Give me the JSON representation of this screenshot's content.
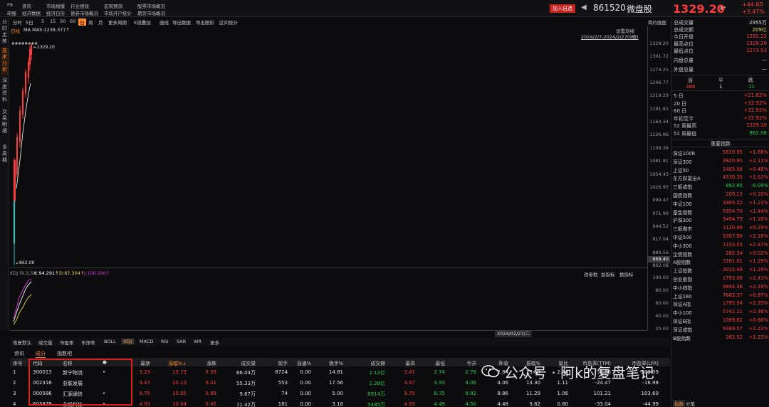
{
  "menu": {
    "row1": [
      "F9",
      "资讯",
      "市场规模",
      "行业绩效",
      "宏观预测",
      "股票市场概况"
    ],
    "row2": [
      "研报",
      "经济数据",
      "经济日历",
      "债券市场概况",
      "市场开户统计",
      "期货市场概况"
    ]
  },
  "header": {
    "add_watch": "加入自选",
    "code": "861520",
    "name": "微盘股",
    "price": "1329.20",
    "change": "+44.60",
    "change_pct": "+3.47%"
  },
  "left_tabs": [
    "分时走势",
    "技术分析",
    "深度资料",
    "交易明细",
    "多周期"
  ],
  "chart_toolbar": {
    "items": [
      "分时",
      "5日",
      "5",
      "15",
      "30",
      "60",
      "日",
      "周",
      "月",
      "更多周期",
      "K线叠加",
      "画线",
      "导出数据",
      "导出图形",
      "区间统计"
    ],
    "selected": "日",
    "right_label": "简约画面",
    "settings": "设置均线",
    "range": "2024/2/7-2024/2/27(9根)"
  },
  "ma_legend": {
    "prefix": "日线",
    "ma": "MA  MA5:1238.377↑"
  },
  "price_axis": [
    "1329.20",
    "1301.72",
    "1274.25",
    "1246.77",
    "1219.29",
    "1191.81",
    "1164.34",
    "1136.86",
    "1109.38",
    "1081.91",
    "1054.43",
    "1026.95",
    "999.47",
    "971.99",
    "944.52",
    "917.04",
    "889.56",
    "862.08"
  ],
  "price_current_tag": "868.40",
  "chart_annotations": {
    "high": "1329.20",
    "low": "862.08"
  },
  "kdj": {
    "label": "KDJ (9,3,3)",
    "k": "K:94.291↑",
    "d": "D:87.304↑",
    "j": "J:108.290↑",
    "actions": [
      "改参数",
      "加指标",
      "换指标"
    ],
    "axis": [
      "100.00",
      "80.00",
      "60.00",
      "40.00",
      "20.00"
    ]
  },
  "date_cursor": "2024/02/27/二",
  "indicator_tabs": [
    "恢复默认",
    "成交量",
    "市盈率",
    "市净率",
    "BOLL",
    "KDJ",
    "MACD",
    "RSI",
    "SAR",
    "WR",
    "更多"
  ],
  "indicator_selected": "KDJ",
  "bottom_tabs": [
    "资讯",
    "成分",
    "指数吧"
  ],
  "bottom_selected": "成分",
  "table": {
    "headers": [
      "序号",
      "代码",
      "名称",
      "●",
      "最新",
      "涨幅%↓",
      "涨跌",
      "成交量",
      "现手",
      "涨速%",
      "换手%",
      "成交额",
      "最高",
      "最低",
      "今开",
      "昨收",
      "振幅%",
      "量比",
      "市盈率(TTM)",
      "市盈率(LYR)"
    ],
    "rows": [
      {
        "idx": "1",
        "code": "300013",
        "name": "新宁物流",
        "dot": "•",
        "last": "3.23",
        "pct": "13.73",
        "chg": "0.39",
        "vol": "66.04万",
        "hand": "8724",
        "speed": "0.00",
        "turn": "14.81",
        "amount": "2.12亿",
        "high": "3.41",
        "low": "2.74",
        "open": "2.78",
        "prev": "2.84",
        "amp": "23.59",
        "ratio": "2.46",
        "pe_ttm": "-32.96",
        "pe_lyr": "-202.09"
      },
      {
        "idx": "2",
        "code": "002316",
        "name": "亚联发展",
        "dot": "",
        "last": "4.47",
        "pct": "10.10",
        "chg": "0.41",
        "vol": "55.33万",
        "hand": "553",
        "speed": "0.00",
        "turn": "17.56",
        "amount": "2.28亿",
        "high": "4.47",
        "low": "3.93",
        "open": "4.06",
        "prev": "4.06",
        "amp": "13.30",
        "ratio": "1.11",
        "pe_ttm": "-24.47",
        "pe_lyr": "-16.98"
      },
      {
        "idx": "3",
        "code": "000586",
        "name": "汇源通信",
        "dot": "•",
        "last": "9.75",
        "pct": "10.05",
        "chg": "0.89",
        "vol": "9.67万",
        "hand": "74",
        "speed": "0.00",
        "turn": "5.00",
        "amount": "8914万",
        "high": "9.75",
        "low": "8.75",
        "open": "8.92",
        "prev": "8.86",
        "amp": "11.29",
        "ratio": "1.06",
        "pe_ttm": "101.21",
        "pe_lyr": "103.60"
      },
      {
        "idx": "4",
        "code": "603879",
        "name": "永悦科技",
        "dot": "•",
        "last": "4.93",
        "pct": "10.04",
        "chg": "0.45",
        "vol": "11.42万",
        "hand": "181",
        "speed": "0.00",
        "turn": "3.18",
        "amount": "5485万",
        "high": "4.93",
        "low": "4.49",
        "open": "4.50",
        "prev": "4.48",
        "amp": "9.82",
        "ratio": "0.80",
        "pe_ttm": "-33.04",
        "pe_lyr": "-44.99"
      }
    ]
  },
  "stats": {
    "total_vol_label": "总成交量",
    "total_vol": "2955万",
    "total_amt_label": "总成交额",
    "total_amt": "209亿",
    "open_label": "今日开盘",
    "open": "1282.22",
    "high_label": "最高点位",
    "high": "1329.20",
    "low_label": "最低点位",
    "low": "1273.53",
    "inner_label": "内盘总量",
    "inner": "—",
    "outer_label": "外盘总量",
    "outer": "—",
    "up_label": "涨",
    "flat_label": "平",
    "down_label": "跌",
    "up": "388",
    "flat": "1",
    "down": "11"
  },
  "periods": [
    {
      "label": "5 日",
      "value": "+21.82%"
    },
    {
      "label": "20 日",
      "value": "+32.92%"
    },
    {
      "label": "60 日",
      "value": "+32.92%"
    },
    {
      "label": "年初至今",
      "value": "+32.92%"
    },
    {
      "label": "52 周最高",
      "value": "1329.20"
    },
    {
      "label": "52 周最低",
      "value": "862.08"
    }
  ],
  "indices_title": "重要指数",
  "indices": [
    {
      "name": "深证100R",
      "value": "5610.95",
      "pct": "+1.88%",
      "up": true
    },
    {
      "name": "深证300",
      "value": "3920.95",
      "pct": "+2.11%",
      "up": true
    },
    {
      "name": "上证50",
      "value": "2405.06",
      "pct": "+0.48%",
      "up": true
    },
    {
      "name": "东方财富全A",
      "value": "4530.35",
      "pct": "+1.62%",
      "up": true
    },
    {
      "name": "三板成指",
      "value": "892.65",
      "pct": "-0.09%",
      "up": false
    },
    {
      "name": "国债指数",
      "value": "209.13",
      "pct": "+0.10%",
      "up": true
    },
    {
      "name": "中证100",
      "value": "3305.22",
      "pct": "+1.21%",
      "up": true
    },
    {
      "name": "基金指数",
      "value": "5954.70",
      "pct": "+1.44%",
      "up": true
    },
    {
      "name": "沪深300",
      "value": "3494.79",
      "pct": "+1.20%",
      "up": true
    },
    {
      "name": "三板做市",
      "value": "1120.99",
      "pct": "+0.29%",
      "up": true
    },
    {
      "name": "中证500",
      "value": "5307.80",
      "pct": "+2.16%",
      "up": true
    },
    {
      "name": "中小300",
      "value": "1153.03",
      "pct": "+2.47%",
      "up": true
    },
    {
      "name": "企债指数",
      "value": "282.34",
      "pct": "+0.02%",
      "up": true
    },
    {
      "name": "A股指数",
      "value": "3161.01",
      "pct": "+1.29%",
      "up": true
    },
    {
      "name": "上证指数",
      "value": "3015.48",
      "pct": "+1.29%",
      "up": true
    },
    {
      "name": "创业板指",
      "value": "1793.98",
      "pct": "+2.41%",
      "up": true
    },
    {
      "name": "中小综指",
      "value": "9844.38",
      "pct": "+2.39%",
      "up": true
    },
    {
      "name": "上证180",
      "value": "7663.37",
      "pct": "+0.87%",
      "up": true
    },
    {
      "name": "深证A指",
      "value": "1795.54",
      "pct": "+2.35%",
      "up": true
    },
    {
      "name": "中小100",
      "value": "5741.21",
      "pct": "+2.46%",
      "up": true
    },
    {
      "name": "深证B指",
      "value": "1069.82",
      "pct": "+0.66%",
      "up": true
    },
    {
      "name": "深证成指",
      "value": "9269.57",
      "pct": "+2.24%",
      "up": true
    },
    {
      "name": "B股指数",
      "value": "262.52",
      "pct": "+1.25%",
      "up": true
    }
  ],
  "right_bottom_tabs": [
    "指数",
    "分笔"
  ],
  "watermark": "公众号 · 阿k的复盘笔记"
}
